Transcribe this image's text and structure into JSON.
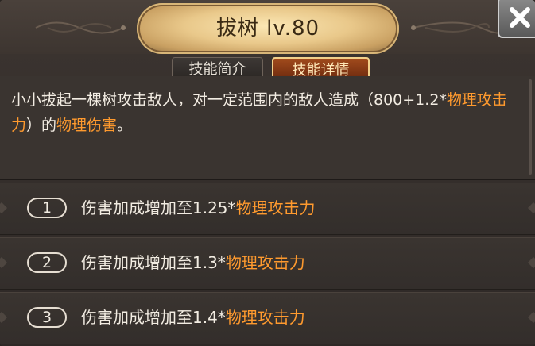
{
  "banner": {
    "title": "拔树 lv.80"
  },
  "tabs": [
    {
      "label": "技能简介",
      "active": false
    },
    {
      "label": "技能详情",
      "active": true
    }
  ],
  "description": {
    "prefix": "小小拔起一棵树攻击敌人，对一定范围内的敌人造成（800+1.2*",
    "hl1": "物理攻击力",
    "mid": "）的",
    "hl2": "物理伤害",
    "suffix": "。"
  },
  "upgrades": [
    {
      "num": "1",
      "text": "伤害加成增加至1.25*",
      "highlight": "物理攻击力"
    },
    {
      "num": "2",
      "text": "伤害加成增加至1.3*",
      "highlight": "物理攻击力"
    },
    {
      "num": "3",
      "text": "伤害加成增加至1.4*",
      "highlight": "物理攻击力"
    }
  ],
  "colors": {
    "highlight": "#ff9a2e",
    "text": "#f2ece2",
    "active_tab": "#a04a1c"
  },
  "icons": {
    "close": "close-icon"
  }
}
